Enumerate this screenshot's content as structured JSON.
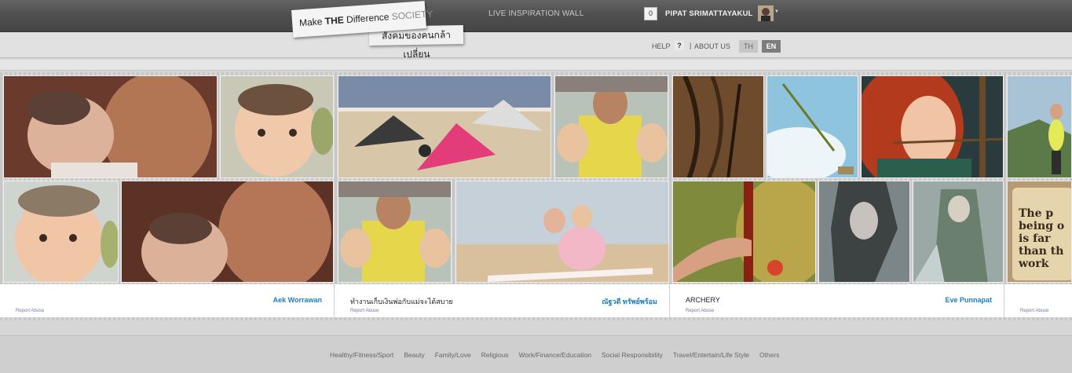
{
  "header": {
    "logo": {
      "make": "Make",
      "the": "THE",
      "difference": "Difference",
      "society": "SOCIETY",
      "thai": "สังคมของคนกล้าเปลี่ยน"
    },
    "wall_link": "LIVE INSPIRATION WALL",
    "notification_count": "0",
    "username": "PIPAT SRIMATTAYAKUL"
  },
  "subnav": {
    "help": "HELP",
    "help_icon": "?",
    "separator": "|",
    "about": "ABOUT US",
    "lang_th": "TH",
    "lang_en": "EN"
  },
  "cards": [
    {
      "title": "",
      "user": "Aek Worrawan",
      "report": "Report Abuse"
    },
    {
      "title": "ทำงานเก็บเงินพ่อกับแม่จะได้สบาย",
      "user": "ณัฐวดี ทรัพย์พร้อม",
      "report": "Report Abuse"
    },
    {
      "title": "ARCHERY",
      "user": "Eve Punnapat",
      "report": "Report Abuse"
    },
    {
      "title": "",
      "user": "",
      "report": "Report Abuse"
    }
  ],
  "poster_text": [
    "The p",
    "being o",
    "is far",
    "than th",
    "work"
  ],
  "categories": [
    "Healthy/Fitness/Sport",
    "Beauty",
    "Family/Love",
    "Religious",
    "Work/Finance/Education",
    "Social Responsibility",
    "Travel/Entertain/Life Style",
    "Others"
  ],
  "colors": {
    "accent": "#1c7fb7",
    "topbar": "#4f4f4f"
  }
}
